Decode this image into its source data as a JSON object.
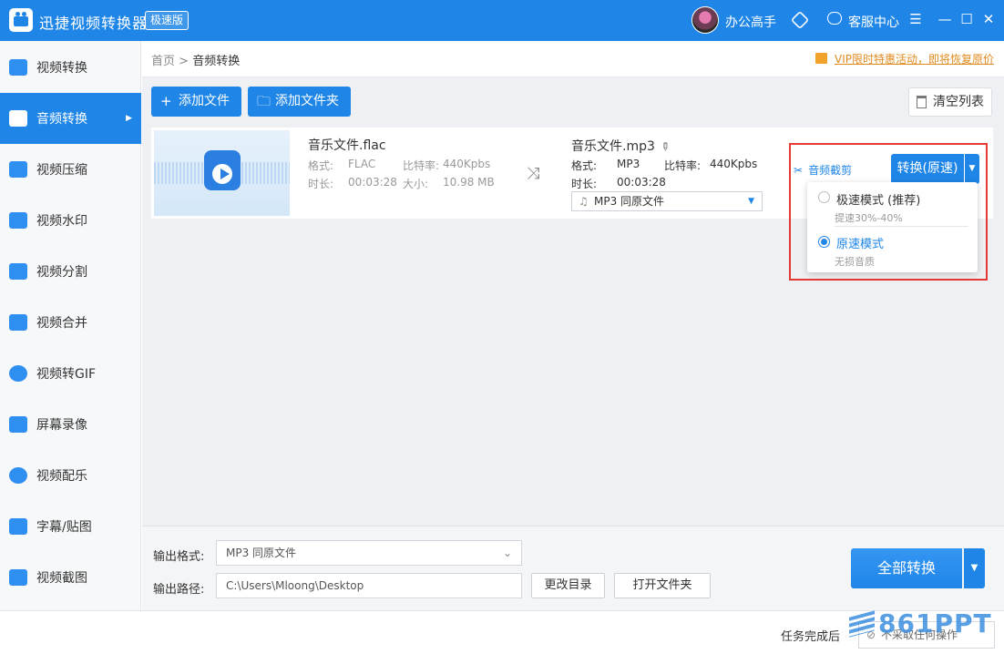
{
  "app": {
    "title": "迅捷视频转换器",
    "badge": "极速版",
    "user_name": "办公高手",
    "service_label": "客服中心",
    "menu_icon": "☰",
    "minimize_icon": "—",
    "maximize_icon": "☐",
    "close_icon": "✕"
  },
  "sidebar": {
    "items": [
      {
        "label": "视频转换"
      },
      {
        "label": "音频转换"
      },
      {
        "label": "视频压缩"
      },
      {
        "label": "视频水印"
      },
      {
        "label": "视频分割"
      },
      {
        "label": "视频合并"
      },
      {
        "label": "视频转GIF"
      },
      {
        "label": "屏幕录像"
      },
      {
        "label": "视频配乐"
      },
      {
        "label": "字幕/贴图"
      },
      {
        "label": "视频截图"
      }
    ],
    "active_index": 1
  },
  "breadcrumb": {
    "home": "首页",
    "separator": ">",
    "current": "音频转换"
  },
  "promo_text": "VIP限时特惠活动，即将恢复原价",
  "toolbar": {
    "add_file": "添加文件",
    "add_folder": "添加文件夹",
    "clear_list": "清空列表"
  },
  "file": {
    "source_name": "音乐文件.flac",
    "format_label": "格式:",
    "format": "FLAC",
    "bitrate_label": "比特率:",
    "bitrate": "440Kpbs",
    "duration_label": "时长:",
    "duration": "00:03:28",
    "size_label": "大小:",
    "size": "10.98 MB",
    "target_name": "音乐文件.mp3",
    "target_format": "MP3",
    "target_bitrate": "440Kpbs",
    "target_duration": "00:03:28",
    "output_select": "MP3  同原文件",
    "cut_label": "音频截剪",
    "convert_label": "转换(原速)"
  },
  "speed_menu": {
    "options": [
      {
        "title": "极速模式 (推荐)",
        "sub": "提速30%-40%",
        "selected": false
      },
      {
        "title": "原速模式",
        "sub": "无损音质",
        "selected": true
      }
    ]
  },
  "bottom": {
    "output_format_label": "输出格式:",
    "output_format_value": "MP3  同原文件",
    "output_path_label": "输出路径:",
    "output_path_value": "C:\\Users\\Mloong\\Desktop",
    "change_dir": "更改目录",
    "open_folder": "打开文件夹",
    "convert_all": "全部转换"
  },
  "footer": {
    "task_label": "任务完成后",
    "task_value": "不采取任何操作",
    "watermark": "861PPT"
  },
  "colors": {
    "accent": "#1f86e8",
    "promo": "#e08a1e",
    "highlight_box": "#e53935"
  }
}
